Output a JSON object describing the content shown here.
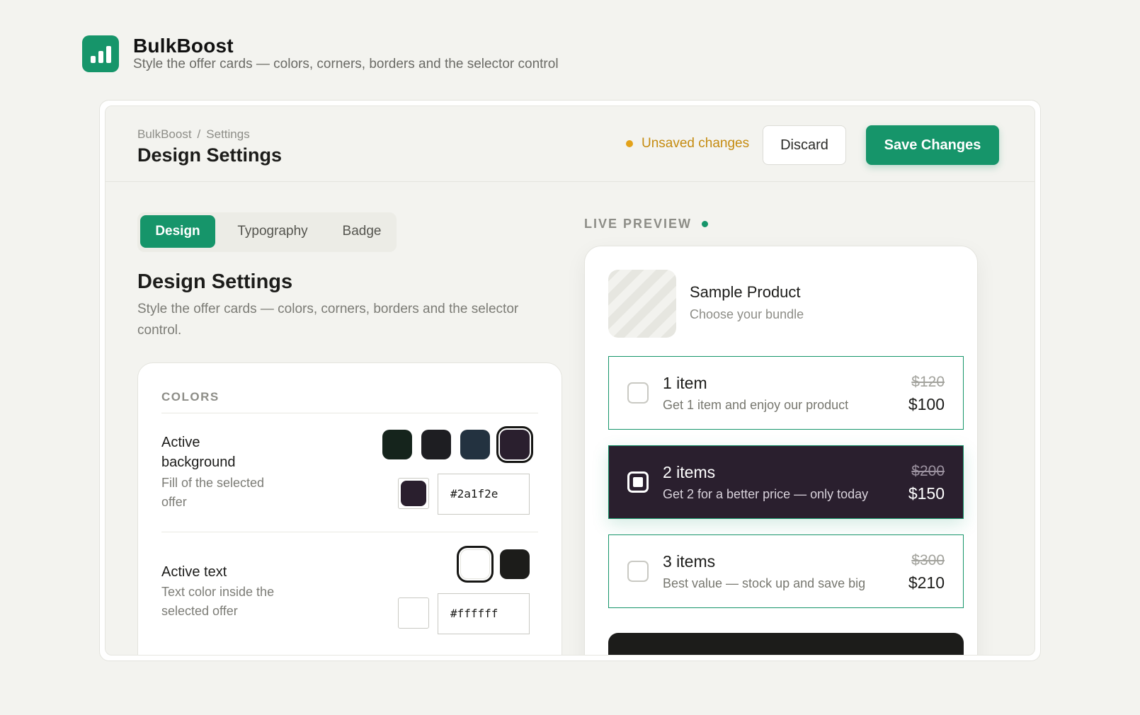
{
  "app": {
    "name": "BulkBoost",
    "tagline": "Style the offer cards — colors, corners, borders and the selector control",
    "brand_color": "#16956a"
  },
  "topbar": {
    "breadcrumb": [
      "BulkBoost",
      "Settings"
    ],
    "breadcrumb_sep": "/",
    "title": "Design Settings",
    "status": "Unsaved changes",
    "discard_label": "Discard",
    "save_label": "Save Changes"
  },
  "tabs": [
    {
      "label": "Design",
      "active": true
    },
    {
      "label": "Typography",
      "active": false
    },
    {
      "label": "Badge",
      "active": false
    }
  ],
  "section": {
    "title": "Design Settings",
    "description": "Style the offer cards — colors, corners, borders and the selector control."
  },
  "colors_card": {
    "heading": "COLORS",
    "rows": [
      {
        "title": "Active background",
        "description": "Fill of the selected offer",
        "swatches": [
          "#15241c",
          "#1e1e22",
          "#233240",
          "#2a1f2e"
        ],
        "selected": "#2a1f2e",
        "value": "#2a1f2e"
      },
      {
        "title": "Active text",
        "description": "Text color inside the selected offer",
        "swatches": [
          "#ffffff",
          "#1c1c1a"
        ],
        "selected": "#ffffff",
        "value": "#ffffff"
      }
    ]
  },
  "preview": {
    "label": "LIVE PREVIEW",
    "product": {
      "name": "Sample Product",
      "subtitle": "Choose your bundle"
    },
    "offers": [
      {
        "title": "1 item",
        "description": "Get 1 item and enjoy our product",
        "old_price": "$120",
        "price": "$100",
        "selected": false
      },
      {
        "title": "2 items",
        "description": "Get 2 for a better price — only today",
        "old_price": "$200",
        "price": "$150",
        "selected": true
      },
      {
        "title": "3 items",
        "description": "Best value — stock up and save big",
        "old_price": "$300",
        "price": "$210",
        "selected": false
      }
    ]
  }
}
